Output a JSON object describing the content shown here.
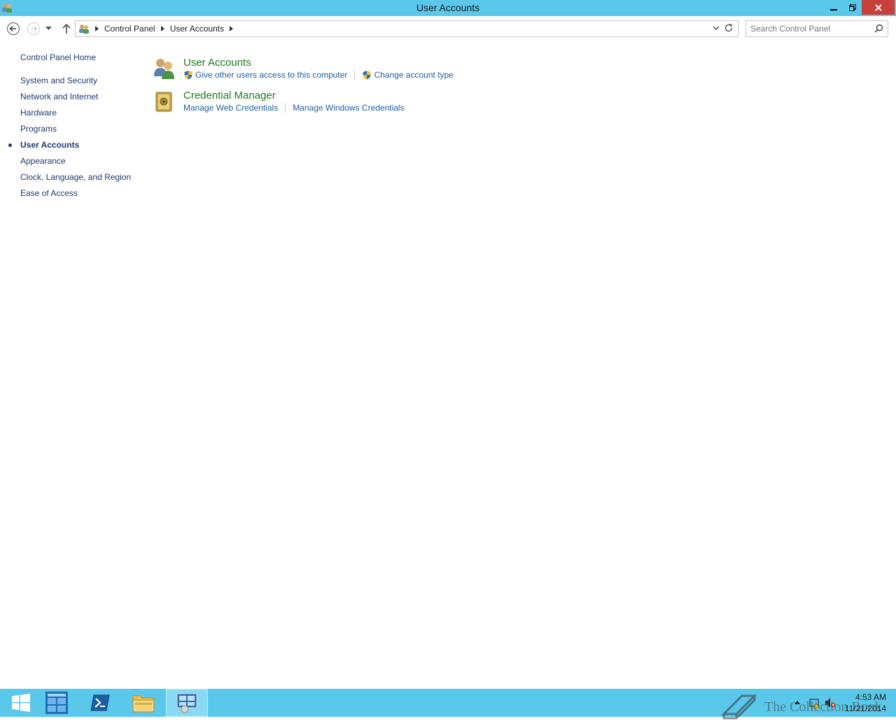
{
  "window": {
    "title": "User Accounts",
    "app_icon": "user-accounts-icon",
    "buttons": {
      "minimize": "minimize-icon",
      "maximize": "restore-icon",
      "close": "close-icon"
    }
  },
  "nav": {
    "back_icon": "back-arrow-icon",
    "forward_icon": "forward-arrow-icon",
    "recent_icon": "chevron-down-icon",
    "up_icon": "up-arrow-icon",
    "breadcrumb": [
      "Control Panel",
      "User Accounts"
    ],
    "search_placeholder": "Search Control Panel"
  },
  "sidebar": {
    "items": [
      {
        "label": "Control Panel Home"
      },
      {
        "label": "System and Security"
      },
      {
        "label": "Network and Internet"
      },
      {
        "label": "Hardware"
      },
      {
        "label": "Programs"
      },
      {
        "label": "User Accounts",
        "active": true
      },
      {
        "label": "Appearance"
      },
      {
        "label": "Clock, Language, and Region"
      },
      {
        "label": "Ease of Access"
      }
    ]
  },
  "categories": [
    {
      "title": "User Accounts",
      "icon": "user-accounts-icon",
      "links": [
        {
          "label": "Give other users access to this computer",
          "shield": true
        },
        {
          "label": "Change account type",
          "shield": true
        }
      ]
    },
    {
      "title": "Credential Manager",
      "icon": "credential-manager-icon",
      "links": [
        {
          "label": "Manage Web Credentials",
          "shield": false
        },
        {
          "label": "Manage Windows Credentials",
          "shield": false
        }
      ]
    }
  ],
  "taskbar": {
    "items": [
      "start-icon",
      "server-manager-icon",
      "powershell-icon",
      "file-explorer-icon",
      "control-panel-icon"
    ],
    "clock": {
      "time": "4:53 AM",
      "date": "11/21/2014"
    },
    "watermark": "The Collection Book"
  },
  "colors": {
    "accent": "#5ac8ea",
    "link": "#1d5fa6",
    "category_title": "#1e7a1e",
    "close_button": "#c7403a"
  }
}
